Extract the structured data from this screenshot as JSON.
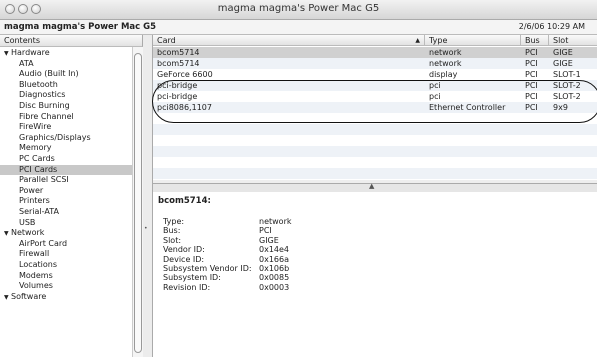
{
  "window": {
    "title": "magma magma's Power Mac G5"
  },
  "info_bar": {
    "machine": "magma magma's Power Mac G5",
    "datetime": "2/6/06 10:29 AM"
  },
  "sidebar": {
    "header": "Contents",
    "items": [
      {
        "label": "Hardware",
        "kind": "cat"
      },
      {
        "label": "ATA",
        "kind": "sub"
      },
      {
        "label": "Audio (Built In)",
        "kind": "sub"
      },
      {
        "label": "Bluetooth",
        "kind": "sub"
      },
      {
        "label": "Diagnostics",
        "kind": "sub"
      },
      {
        "label": "Disc Burning",
        "kind": "sub"
      },
      {
        "label": "Fibre Channel",
        "kind": "sub"
      },
      {
        "label": "FireWire",
        "kind": "sub"
      },
      {
        "label": "Graphics/Displays",
        "kind": "sub"
      },
      {
        "label": "Memory",
        "kind": "sub"
      },
      {
        "label": "PC Cards",
        "kind": "sub"
      },
      {
        "label": "PCI Cards",
        "kind": "sub",
        "selected": true
      },
      {
        "label": "Parallel SCSI",
        "kind": "sub"
      },
      {
        "label": "Power",
        "kind": "sub"
      },
      {
        "label": "Printers",
        "kind": "sub"
      },
      {
        "label": "Serial-ATA",
        "kind": "sub"
      },
      {
        "label": "USB",
        "kind": "sub"
      },
      {
        "label": "Network",
        "kind": "cat"
      },
      {
        "label": "AirPort Card",
        "kind": "sub"
      },
      {
        "label": "Firewall",
        "kind": "sub"
      },
      {
        "label": "Locations",
        "kind": "sub"
      },
      {
        "label": "Modems",
        "kind": "sub"
      },
      {
        "label": "Volumes",
        "kind": "sub"
      },
      {
        "label": "Software",
        "kind": "cat"
      }
    ]
  },
  "table": {
    "columns": [
      {
        "label": "Card"
      },
      {
        "label": "Type"
      },
      {
        "label": "Bus"
      },
      {
        "label": "Slot"
      }
    ],
    "sort_indicator": "▲",
    "rows": [
      {
        "card": "bcom5714",
        "type": "network",
        "bus": "PCI",
        "slot": "GIGE",
        "selected": true
      },
      {
        "card": "bcom5714",
        "type": "network",
        "bus": "PCI",
        "slot": "GIGE"
      },
      {
        "card": "GeForce 6600",
        "type": "display",
        "bus": "PCI",
        "slot": "SLOT-1"
      },
      {
        "card": "pci-bridge",
        "type": "pci",
        "bus": "PCI",
        "slot": "SLOT-2"
      },
      {
        "card": "pci-bridge",
        "type": "pci",
        "bus": "PCI",
        "slot": "SLOT-2"
      },
      {
        "card": "pci8086,1107",
        "type": "Ethernet Controller",
        "bus": "PCI",
        "slot": "9x9"
      }
    ]
  },
  "detail": {
    "title": "bcom5714:",
    "fields": [
      {
        "key": "Type:",
        "value": "network"
      },
      {
        "key": "Bus:",
        "value": "PCI"
      },
      {
        "key": "Slot:",
        "value": "GIGE"
      },
      {
        "key": "Vendor ID:",
        "value": "0x14e4"
      },
      {
        "key": "Device ID:",
        "value": "0x166a"
      },
      {
        "key": "Subsystem Vendor ID:",
        "value": "0x106b"
      },
      {
        "key": "Subsystem ID:",
        "value": "0x0085"
      },
      {
        "key": "Revision ID:",
        "value": "0x0003"
      }
    ]
  },
  "icons": {
    "expanded": "▼",
    "splitter_dot": "•",
    "splitter_up": "▲"
  }
}
